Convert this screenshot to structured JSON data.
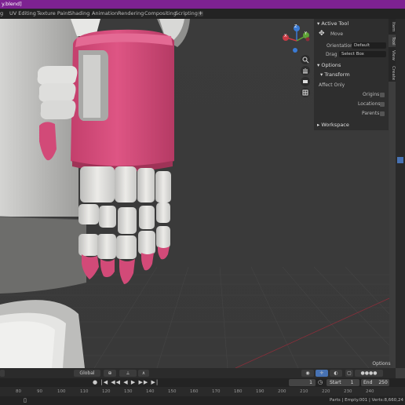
{
  "window": {
    "title_fragment": "y.blend]"
  },
  "workspace_tabs": [
    "g",
    "UV Editing",
    "Texture Paint",
    "Shading",
    "Animation",
    "Rendering",
    "Compositing",
    "Scripting"
  ],
  "workspace_add": "+",
  "gizmo": {
    "x": "X",
    "y": "Y",
    "z": "Z"
  },
  "sidebar_tabs": [
    "Item",
    "Tool",
    "View",
    "Create"
  ],
  "active_tool": {
    "header": "Active Tool",
    "tool_name": "Move",
    "orientation_label": "Orientation",
    "orientation_value": "Default",
    "drag_label": "Drag",
    "drag_value": "Select Box"
  },
  "options": {
    "header": "Options",
    "transform_header": "Transform",
    "affect_only": "Affect Only",
    "origins": "Origins",
    "locations": "Locations",
    "parents": "Parents"
  },
  "workspace_panel": {
    "header": "Workspace"
  },
  "viewport_header": {
    "orientation": "Global",
    "options": "Options"
  },
  "timeline": {
    "current_frame": "1",
    "start_label": "Start",
    "start_value": "1",
    "end_label": "End",
    "end_value": "250"
  },
  "ruler_ticks": [
    "80",
    "90",
    "100",
    "110",
    "120",
    "130",
    "140",
    "150",
    "160",
    "170",
    "180",
    "190",
    "200",
    "210",
    "220",
    "230",
    "240"
  ],
  "status": {
    "text": "Parts | Empty.001 | Verts:8,660,24"
  },
  "colors": {
    "accent": "#7d2291",
    "hand_pink": "#d24a78",
    "panel_bg": "#2e2e2e"
  }
}
